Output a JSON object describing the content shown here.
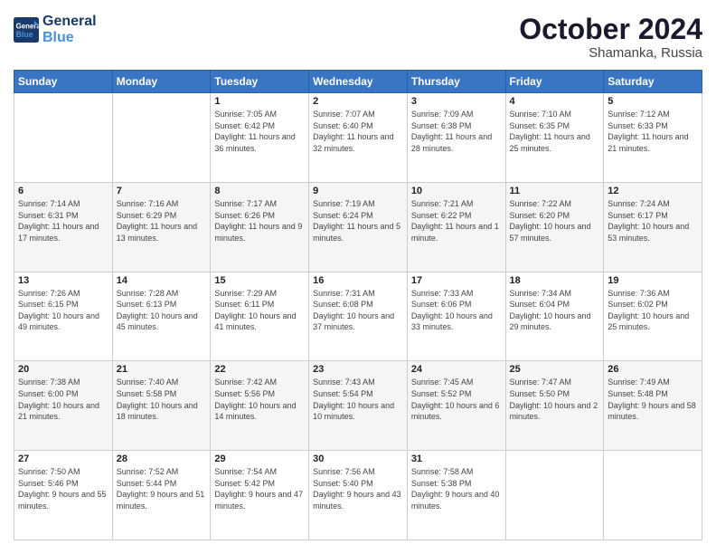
{
  "logo": {
    "line1": "General",
    "line2": "Blue"
  },
  "title": "October 2024",
  "location": "Shamanka, Russia",
  "weekdays": [
    "Sunday",
    "Monday",
    "Tuesday",
    "Wednesday",
    "Thursday",
    "Friday",
    "Saturday"
  ],
  "weeks": [
    [
      {
        "day": "",
        "info": ""
      },
      {
        "day": "",
        "info": ""
      },
      {
        "day": "1",
        "info": "Sunrise: 7:05 AM\nSunset: 6:42 PM\nDaylight: 11 hours and 36 minutes."
      },
      {
        "day": "2",
        "info": "Sunrise: 7:07 AM\nSunset: 6:40 PM\nDaylight: 11 hours and 32 minutes."
      },
      {
        "day": "3",
        "info": "Sunrise: 7:09 AM\nSunset: 6:38 PM\nDaylight: 11 hours and 28 minutes."
      },
      {
        "day": "4",
        "info": "Sunrise: 7:10 AM\nSunset: 6:35 PM\nDaylight: 11 hours and 25 minutes."
      },
      {
        "day": "5",
        "info": "Sunrise: 7:12 AM\nSunset: 6:33 PM\nDaylight: 11 hours and 21 minutes."
      }
    ],
    [
      {
        "day": "6",
        "info": "Sunrise: 7:14 AM\nSunset: 6:31 PM\nDaylight: 11 hours and 17 minutes."
      },
      {
        "day": "7",
        "info": "Sunrise: 7:16 AM\nSunset: 6:29 PM\nDaylight: 11 hours and 13 minutes."
      },
      {
        "day": "8",
        "info": "Sunrise: 7:17 AM\nSunset: 6:26 PM\nDaylight: 11 hours and 9 minutes."
      },
      {
        "day": "9",
        "info": "Sunrise: 7:19 AM\nSunset: 6:24 PM\nDaylight: 11 hours and 5 minutes."
      },
      {
        "day": "10",
        "info": "Sunrise: 7:21 AM\nSunset: 6:22 PM\nDaylight: 11 hours and 1 minute."
      },
      {
        "day": "11",
        "info": "Sunrise: 7:22 AM\nSunset: 6:20 PM\nDaylight: 10 hours and 57 minutes."
      },
      {
        "day": "12",
        "info": "Sunrise: 7:24 AM\nSunset: 6:17 PM\nDaylight: 10 hours and 53 minutes."
      }
    ],
    [
      {
        "day": "13",
        "info": "Sunrise: 7:26 AM\nSunset: 6:15 PM\nDaylight: 10 hours and 49 minutes."
      },
      {
        "day": "14",
        "info": "Sunrise: 7:28 AM\nSunset: 6:13 PM\nDaylight: 10 hours and 45 minutes."
      },
      {
        "day": "15",
        "info": "Sunrise: 7:29 AM\nSunset: 6:11 PM\nDaylight: 10 hours and 41 minutes."
      },
      {
        "day": "16",
        "info": "Sunrise: 7:31 AM\nSunset: 6:08 PM\nDaylight: 10 hours and 37 minutes."
      },
      {
        "day": "17",
        "info": "Sunrise: 7:33 AM\nSunset: 6:06 PM\nDaylight: 10 hours and 33 minutes."
      },
      {
        "day": "18",
        "info": "Sunrise: 7:34 AM\nSunset: 6:04 PM\nDaylight: 10 hours and 29 minutes."
      },
      {
        "day": "19",
        "info": "Sunrise: 7:36 AM\nSunset: 6:02 PM\nDaylight: 10 hours and 25 minutes."
      }
    ],
    [
      {
        "day": "20",
        "info": "Sunrise: 7:38 AM\nSunset: 6:00 PM\nDaylight: 10 hours and 21 minutes."
      },
      {
        "day": "21",
        "info": "Sunrise: 7:40 AM\nSunset: 5:58 PM\nDaylight: 10 hours and 18 minutes."
      },
      {
        "day": "22",
        "info": "Sunrise: 7:42 AM\nSunset: 5:56 PM\nDaylight: 10 hours and 14 minutes."
      },
      {
        "day": "23",
        "info": "Sunrise: 7:43 AM\nSunset: 5:54 PM\nDaylight: 10 hours and 10 minutes."
      },
      {
        "day": "24",
        "info": "Sunrise: 7:45 AM\nSunset: 5:52 PM\nDaylight: 10 hours and 6 minutes."
      },
      {
        "day": "25",
        "info": "Sunrise: 7:47 AM\nSunset: 5:50 PM\nDaylight: 10 hours and 2 minutes."
      },
      {
        "day": "26",
        "info": "Sunrise: 7:49 AM\nSunset: 5:48 PM\nDaylight: 9 hours and 58 minutes."
      }
    ],
    [
      {
        "day": "27",
        "info": "Sunrise: 7:50 AM\nSunset: 5:46 PM\nDaylight: 9 hours and 55 minutes."
      },
      {
        "day": "28",
        "info": "Sunrise: 7:52 AM\nSunset: 5:44 PM\nDaylight: 9 hours and 51 minutes."
      },
      {
        "day": "29",
        "info": "Sunrise: 7:54 AM\nSunset: 5:42 PM\nDaylight: 9 hours and 47 minutes."
      },
      {
        "day": "30",
        "info": "Sunrise: 7:56 AM\nSunset: 5:40 PM\nDaylight: 9 hours and 43 minutes."
      },
      {
        "day": "31",
        "info": "Sunrise: 7:58 AM\nSunset: 5:38 PM\nDaylight: 9 hours and 40 minutes."
      },
      {
        "day": "",
        "info": ""
      },
      {
        "day": "",
        "info": ""
      }
    ]
  ]
}
